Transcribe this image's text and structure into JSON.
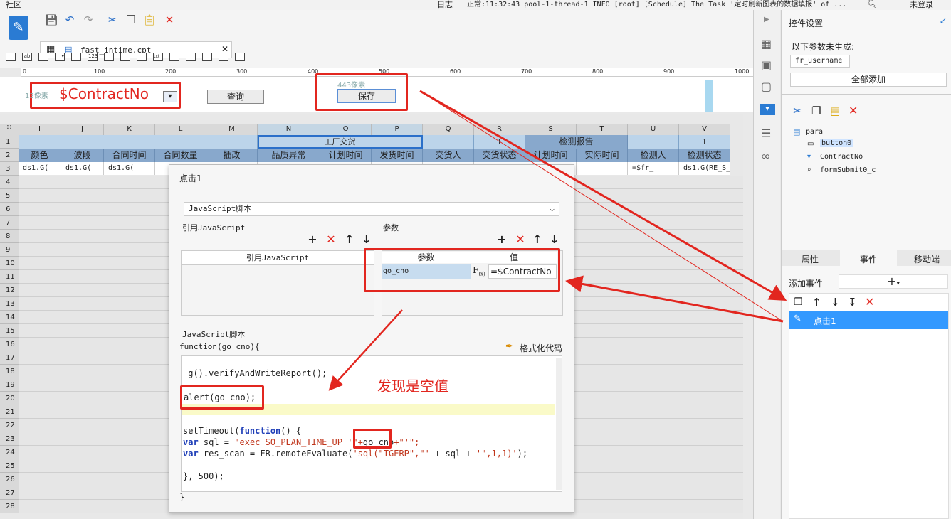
{
  "titlebar": {
    "app": "社区",
    "log_label": "日志",
    "log_text": "正常:11:32:43 pool-1-thread-1 INFO [root] [Schedule] The Task '定时刷新图表的数据填报' of ...",
    "login": "未登录"
  },
  "toolbar": {
    "tab_file": "fast_intime.cpt"
  },
  "ruler": {
    "ticks": [
      "0",
      "100",
      "200",
      "300",
      "400",
      "500",
      "600",
      "700",
      "800",
      "900",
      "1000"
    ]
  },
  "form": {
    "contract_placeholder": "13像素",
    "contract_value": "$ContractNo",
    "query_button": "查询",
    "save_button": "保存",
    "save_hint": "443像素"
  },
  "grid": {
    "columns": [
      "I",
      "J",
      "K",
      "L",
      "M",
      "N",
      "O",
      "P",
      "Q",
      "R",
      "S",
      "T",
      "U",
      "V"
    ],
    "rows": [
      "1 (H)",
      "2 (H)",
      "3",
      "4",
      "5",
      "6",
      "7",
      "8",
      "9",
      "10",
      "11",
      "12",
      "13",
      "14",
      "15",
      "16",
      "17",
      "18",
      "19",
      "20",
      "21",
      "22",
      "23",
      "24",
      "25",
      "26",
      "27",
      "28"
    ],
    "row1": {
      "factory": "工厂交货",
      "r1": "1",
      "report": "检测报告",
      "v1": "1"
    },
    "row2": [
      "颜色",
      "波段",
      "合同时间",
      "合同数量",
      "插改",
      "品质异常",
      "计划时间",
      "发货时间",
      "交货人",
      "交货状态",
      "计划时间",
      "实际时间",
      "检测人",
      "检测状态"
    ],
    "row3": [
      "ds1.G(",
      "ds1.G(",
      "ds1.G(",
      "",
      "",
      "",
      "",
      "",
      "",
      "",
      "ds1.G(RE_S",
      "",
      "=$fr_",
      "ds1.G(RE_S_"
    ]
  },
  "side": {
    "title": "控件设置",
    "not_generated": "以下参数未生成:",
    "param_username": "fr_username",
    "add_all": "全部添加",
    "tree_root": "para",
    "tree_items": [
      "button0",
      "ContractNo",
      "formSubmit0_c"
    ],
    "tabs": [
      "属性",
      "事件",
      "移动端"
    ],
    "add_event": "添加事件",
    "event_item": "点击1"
  },
  "dialog": {
    "title": "点击1",
    "type_select": "JavaScript脚本",
    "ref_js_title": "引用JavaScript",
    "params_title": "参数",
    "ref_js_col": "引用JavaScript",
    "param_col": "参数",
    "value_col": "值",
    "param_name": "go_cno",
    "param_value": "=$ContractNo",
    "script_title": "JavaScript脚本",
    "function_sig": "function(go_cno){",
    "format_code": "格式化代码",
    "code_line1": "_g().verifyAndWriteReport();",
    "code_alert": "alert(go_cno);",
    "code_settimeout": "setTimeout(function() {",
    "code_sql_a": "var sql = ",
    "code_sql_b": "\"exec SO_PLAN_TIME_UP '\"+",
    "code_sql_c": "go_cno",
    "code_sql_d": "+\"'\";",
    "code_res": "var res_scan = FR.remoteEvaluate('sql(\"TGERP\",\"' + sql + '\",1,1)');",
    "code_close": "}, 500);",
    "closing_brace": "}"
  },
  "annotation": {
    "note": "发现是空值"
  },
  "colors": {
    "accent_red": "#e2261f",
    "header_blue": "#88a8cc",
    "event_selected": "#3399ff"
  }
}
